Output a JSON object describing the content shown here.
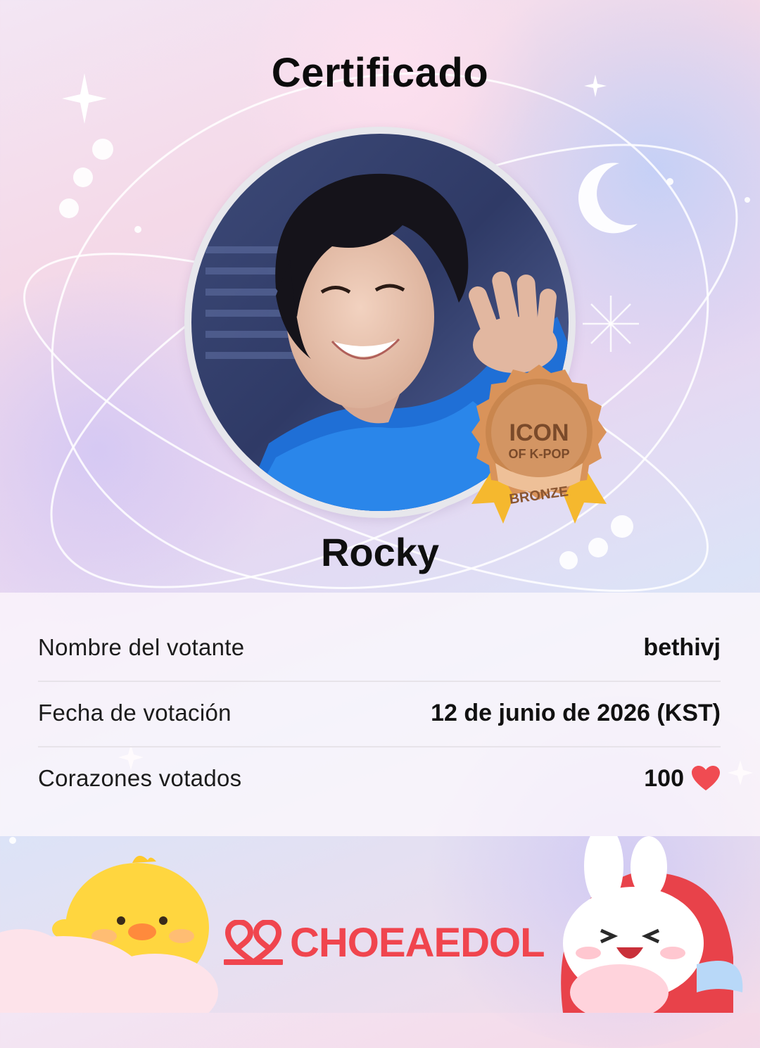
{
  "certificate": {
    "title": "Certificado",
    "idol_name": "Rocky",
    "badge": {
      "line1": "ICON",
      "line2": "OF K-POP",
      "tier": "BRONZE"
    }
  },
  "details": [
    {
      "label": "Nombre del votante",
      "value": "bethivj"
    },
    {
      "label": "Fecha de votación",
      "value": "12 de junio de 2026 (KST)"
    },
    {
      "label": "Corazones votados",
      "value": "100"
    }
  ],
  "brand": {
    "name": "CHOEAEDOL"
  },
  "icons": {
    "heart": "heart-icon",
    "logo": "choeaedol-logo-icon",
    "moon": "moon-icon",
    "sparkle": "sparkle-icon"
  },
  "colors": {
    "accent": "#f0454e",
    "heart": "#f04b52",
    "bronze": "#c9864e"
  }
}
